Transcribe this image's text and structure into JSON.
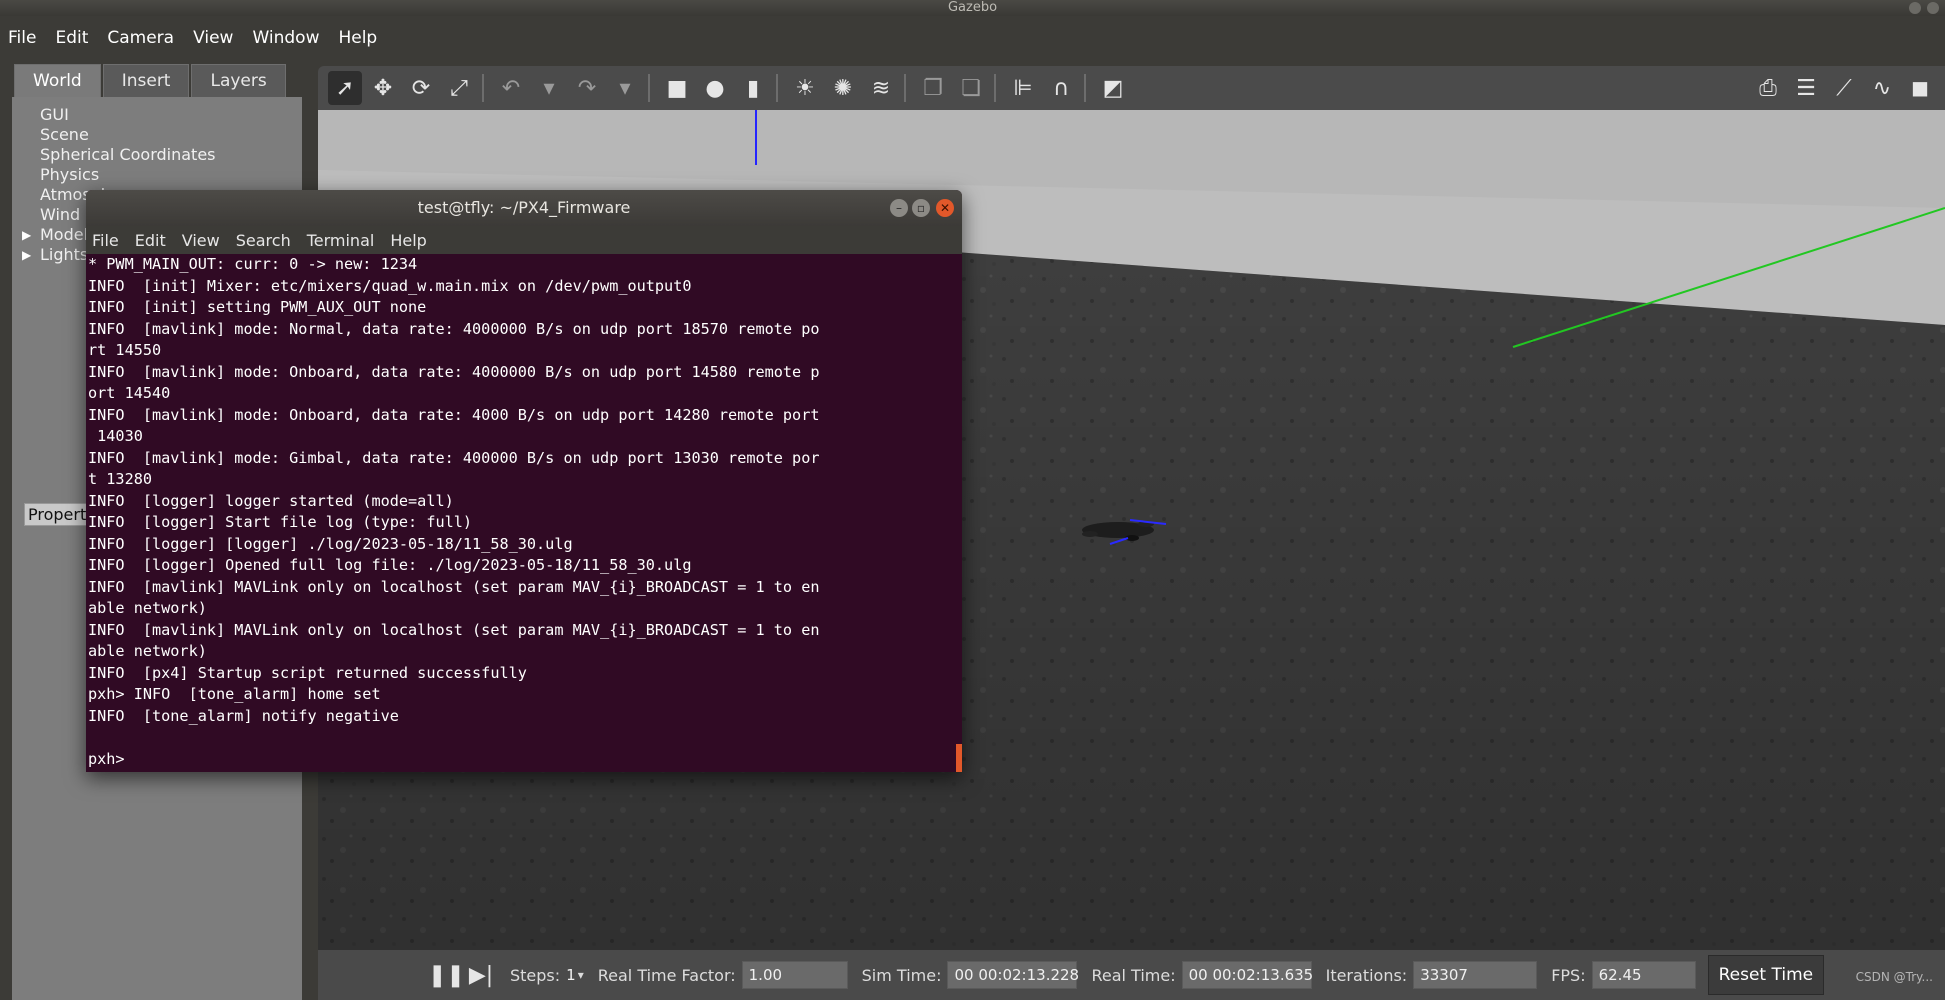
{
  "window": {
    "title": "Gazebo"
  },
  "menu": {
    "items": [
      "File",
      "Edit",
      "Camera",
      "View",
      "Window",
      "Help"
    ]
  },
  "left_panel": {
    "tabs": [
      "World",
      "Insert",
      "Layers"
    ],
    "world_items": [
      {
        "label": "GUI",
        "expandable": false
      },
      {
        "label": "Scene",
        "expandable": false
      },
      {
        "label": "Spherical Coordinates",
        "expandable": false
      },
      {
        "label": "Physics",
        "expandable": false
      },
      {
        "label": "Atmosphere",
        "expandable": false
      },
      {
        "label": "Wind",
        "expandable": false
      },
      {
        "label": "Models",
        "expandable": true
      },
      {
        "label": "Lights",
        "expandable": true
      }
    ],
    "property_label": "Property"
  },
  "toolbar": {
    "icons": [
      {
        "name": "select-mode-icon",
        "glyph": "➚",
        "active": true
      },
      {
        "name": "translate-mode-icon",
        "glyph": "✥"
      },
      {
        "name": "rotate-mode-icon",
        "glyph": "⟳"
      },
      {
        "name": "scale-mode-icon",
        "glyph": "⤢"
      },
      {
        "sep": true
      },
      {
        "name": "undo-icon",
        "glyph": "↶",
        "dim": true
      },
      {
        "name": "undo-dropdown-icon",
        "glyph": "▾",
        "dim": true
      },
      {
        "name": "redo-icon",
        "glyph": "↷",
        "dim": true
      },
      {
        "name": "redo-dropdown-icon",
        "glyph": "▾",
        "dim": true
      },
      {
        "sep": true
      },
      {
        "name": "box-shape-icon",
        "glyph": "■"
      },
      {
        "name": "sphere-shape-icon",
        "glyph": "●"
      },
      {
        "name": "cylinder-shape-icon",
        "glyph": "▮"
      },
      {
        "sep": true
      },
      {
        "name": "point-light-icon",
        "glyph": "☀"
      },
      {
        "name": "spot-light-icon",
        "glyph": "✺"
      },
      {
        "name": "directional-light-icon",
        "glyph": "≋"
      },
      {
        "sep": true
      },
      {
        "name": "copy-icon",
        "glyph": "❐",
        "dim": true
      },
      {
        "name": "paste-icon",
        "glyph": "❏",
        "dim": true
      },
      {
        "sep": true
      },
      {
        "name": "align-icon",
        "glyph": "⊫"
      },
      {
        "name": "snap-icon",
        "glyph": "∩"
      },
      {
        "sep": true
      },
      {
        "name": "view-angle-icon",
        "glyph": "◩"
      }
    ],
    "right_icons": [
      {
        "name": "screenshot-icon",
        "glyph": "⎙"
      },
      {
        "name": "log-icon",
        "glyph": "☰"
      },
      {
        "name": "plot-icon",
        "glyph": "⟋"
      },
      {
        "name": "plot-line-icon",
        "glyph": "∿"
      },
      {
        "name": "video-record-icon",
        "glyph": "◼"
      }
    ]
  },
  "terminal": {
    "title": "test@tfly: ~/PX4_Firmware",
    "menu": [
      "File",
      "Edit",
      "View",
      "Search",
      "Terminal",
      "Help"
    ],
    "lines": [
      "* PWM_MAIN_OUT: curr: 0 -> new: 1234",
      "INFO  [init] Mixer: etc/mixers/quad_w.main.mix on /dev/pwm_output0",
      "INFO  [init] setting PWM_AUX_OUT none",
      "INFO  [mavlink] mode: Normal, data rate: 4000000 B/s on udp port 18570 remote po",
      "rt 14550",
      "INFO  [mavlink] mode: Onboard, data rate: 4000000 B/s on udp port 14580 remote p",
      "ort 14540",
      "INFO  [mavlink] mode: Onboard, data rate: 4000 B/s on udp port 14280 remote port",
      " 14030",
      "INFO  [mavlink] mode: Gimbal, data rate: 400000 B/s on udp port 13030 remote por",
      "t 13280",
      "INFO  [logger] logger started (mode=all)",
      "INFO  [logger] Start file log (type: full)",
      "INFO  [logger] [logger] ./log/2023-05-18/11_58_30.ulg",
      "INFO  [logger] Opened full log file: ./log/2023-05-18/11_58_30.ulg",
      "INFO  [mavlink] MAVLink only on localhost (set param MAV_{i}_BROADCAST = 1 to en",
      "able network)",
      "INFO  [mavlink] MAVLink only on localhost (set param MAV_{i}_BROADCAST = 1 to en",
      "able network)",
      "INFO  [px4] Startup script returned successfully",
      "pxh> INFO  [tone_alarm] home set",
      "INFO  [tone_alarm] notify negative",
      "",
      "pxh> "
    ]
  },
  "status": {
    "steps_label": "Steps:",
    "steps_value": "1",
    "rtf_label": "Real Time Factor:",
    "rtf_value": "1.00",
    "sim_time_label": "Sim Time:",
    "sim_time_value": "00 00:02:13.228",
    "real_time_label": "Real Time:",
    "real_time_value": "00 00:02:13.635",
    "iterations_label": "Iterations:",
    "iterations_value": "33307",
    "fps_label": "FPS:",
    "fps_value": "62.45",
    "reset_label": "Reset Time",
    "watermark": "CSDN @Try..."
  },
  "colors": {
    "terminal_bg": "#300a24",
    "sky_wall": "#b9b9b9",
    "ground": "#4b4b4b",
    "close_button": "#e2582a"
  }
}
